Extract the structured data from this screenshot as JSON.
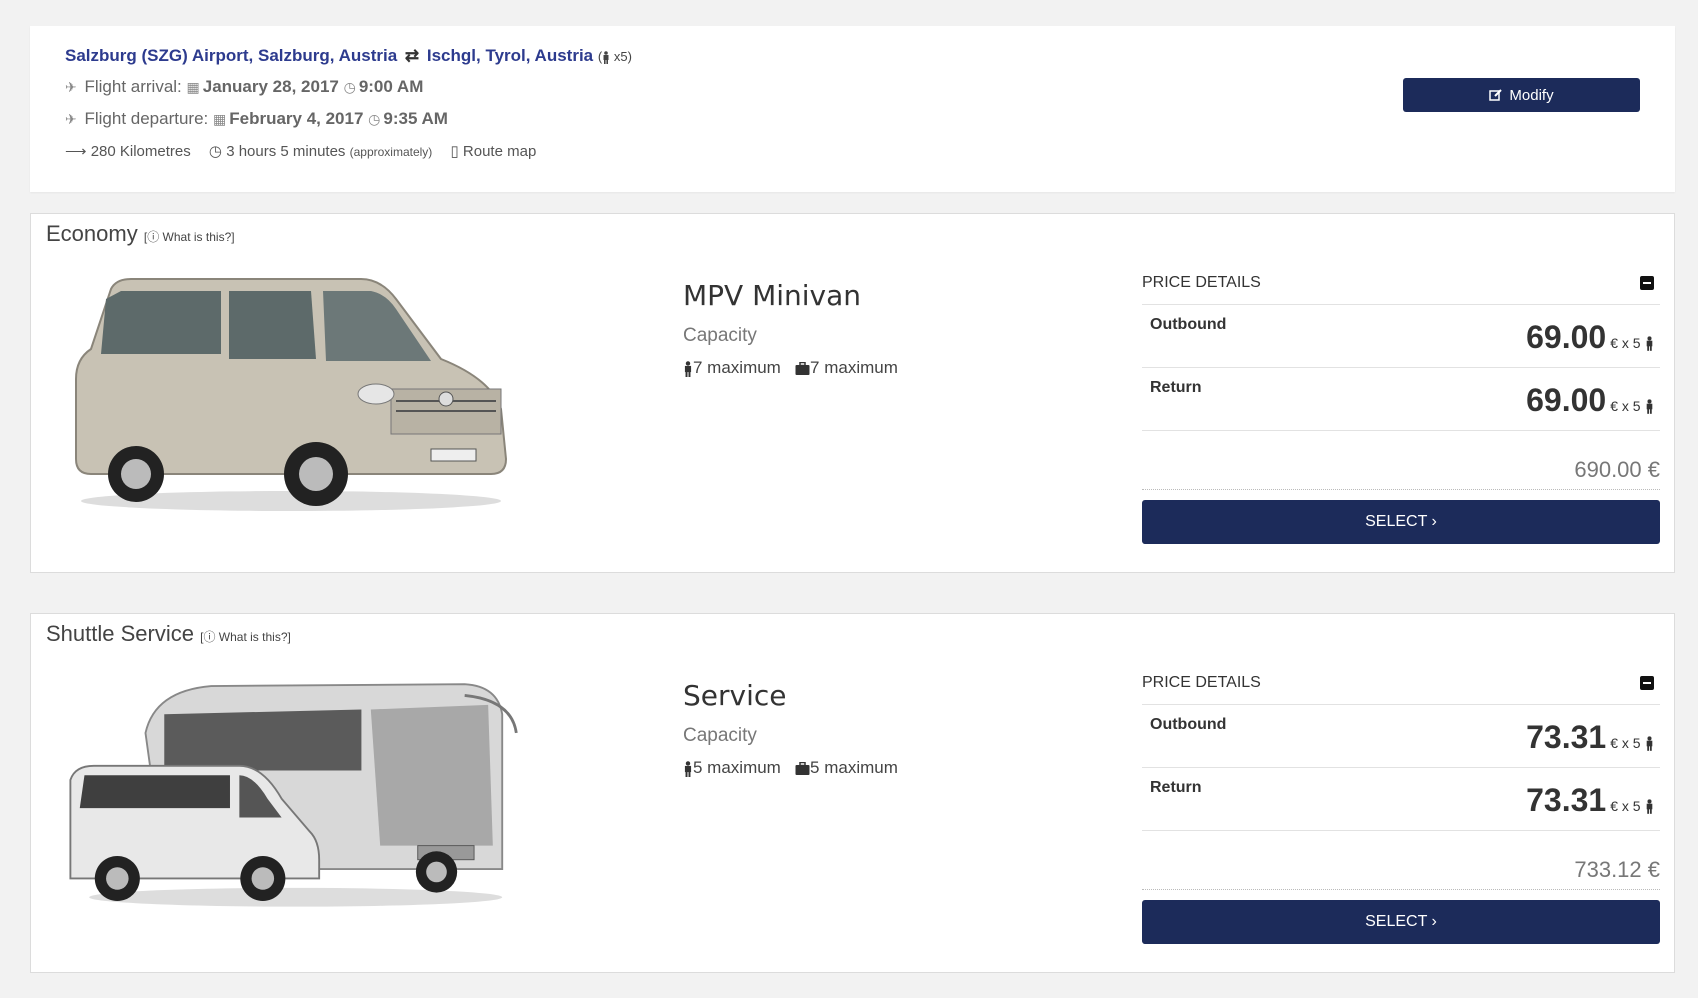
{
  "summary": {
    "origin": "Salzburg (SZG) Airport, Salzburg, Austria",
    "destination": "Ischgl, Tyrol, Austria",
    "passengers": "x5)",
    "arrival_label": "Flight arrival:",
    "arrival_date": "January 28, 2017",
    "arrival_time": "9:00 AM",
    "departure_label": "Flight departure:",
    "departure_date": "February 4, 2017",
    "departure_time": "9:35 AM",
    "distance": "280 Kilometres",
    "duration": "3 hours 5 minutes",
    "duration_note": "(approximately)",
    "route_map": "Route map",
    "modify_label": "Modify"
  },
  "offers": [
    {
      "category": "Economy",
      "what_is_this": "What is this?]",
      "vehicle_name": "MPV Minivan",
      "capacity_label": "Capacity",
      "max_passengers": "7 maximum",
      "max_luggage": "7 maximum",
      "price_header": "PRICE DETAILS",
      "outbound_label": "Outbound",
      "outbound_price": "69.00",
      "return_label": "Return",
      "return_price": "69.00",
      "unit": "€ x 5",
      "total": "690.00 €",
      "select_label": "SELECT ›"
    },
    {
      "category": "Shuttle Service",
      "what_is_this": "What is this?]",
      "vehicle_name": "Service",
      "capacity_label": "Capacity",
      "max_passengers": "5 maximum",
      "max_luggage": "5 maximum",
      "price_header": "PRICE DETAILS",
      "outbound_label": "Outbound",
      "outbound_price": "73.31",
      "return_label": "Return",
      "return_price": "73.31",
      "unit": "€ x 5",
      "total": "733.12 €",
      "select_label": "SELECT ›"
    }
  ],
  "colors": {
    "accent": "#1c2b5a",
    "link": "#2d3b8e"
  }
}
